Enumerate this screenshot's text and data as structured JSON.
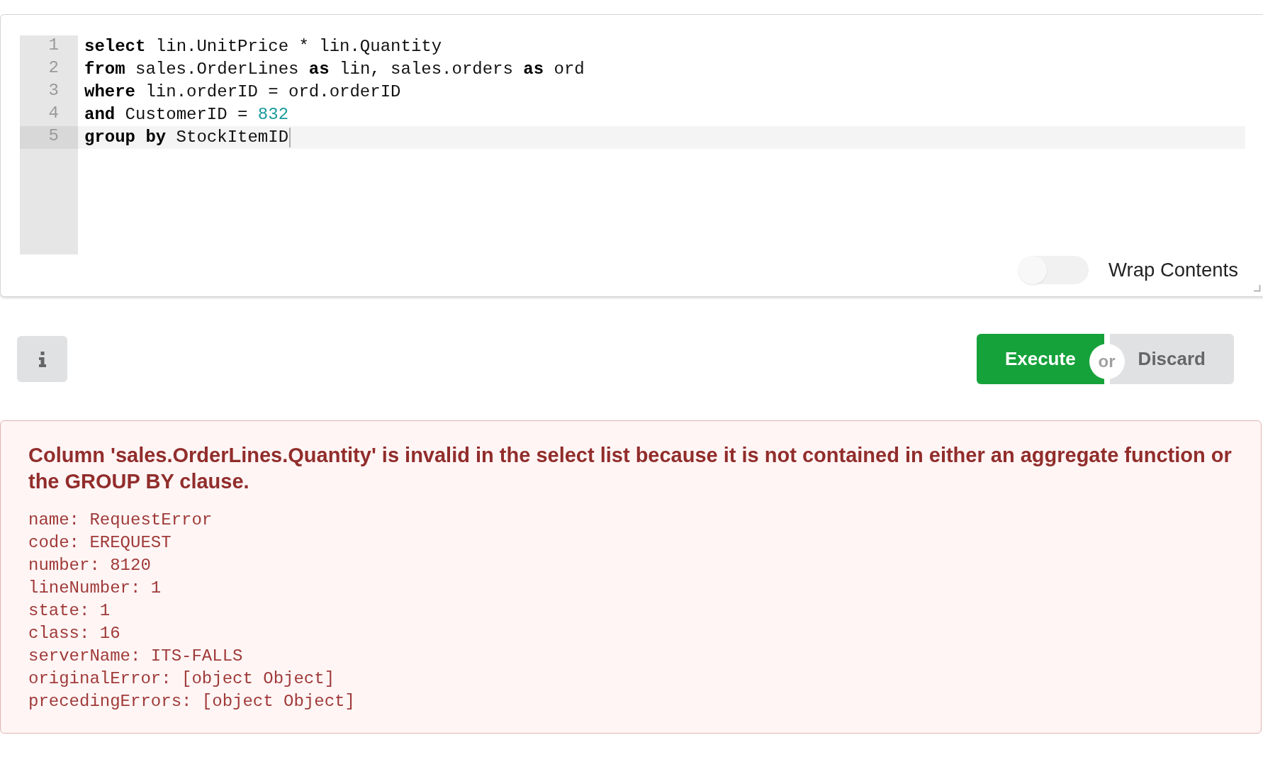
{
  "editor": {
    "lines": [
      {
        "number": "1",
        "active": false,
        "tokens": [
          {
            "kind": "keyword",
            "text": "select"
          },
          {
            "kind": "plain",
            "text": " lin.UnitPrice * lin.Quantity"
          }
        ]
      },
      {
        "number": "2",
        "active": false,
        "tokens": [
          {
            "kind": "keyword",
            "text": "from"
          },
          {
            "kind": "plain",
            "text": " sales.OrderLines "
          },
          {
            "kind": "keyword",
            "text": "as"
          },
          {
            "kind": "plain",
            "text": " lin, sales.orders "
          },
          {
            "kind": "keyword",
            "text": "as"
          },
          {
            "kind": "plain",
            "text": " ord"
          }
        ]
      },
      {
        "number": "3",
        "active": false,
        "tokens": [
          {
            "kind": "keyword",
            "text": "where"
          },
          {
            "kind": "plain",
            "text": " lin.orderID = ord.orderID"
          }
        ]
      },
      {
        "number": "4",
        "active": false,
        "tokens": [
          {
            "kind": "keyword",
            "text": "and"
          },
          {
            "kind": "plain",
            "text": " CustomerID = "
          },
          {
            "kind": "number",
            "text": "832"
          }
        ]
      },
      {
        "number": "5",
        "active": true,
        "tokens": [
          {
            "kind": "keyword",
            "text": "group by"
          },
          {
            "kind": "plain",
            "text": " StockItemID"
          }
        ]
      }
    ],
    "wrap_contents": {
      "label": "Wrap Contents",
      "on": false
    }
  },
  "actions": {
    "buttons": [
      {
        "kind": "primary",
        "label": "Execute"
      },
      {
        "kind": "secondary",
        "label": "Discard"
      }
    ],
    "separator": "or"
  },
  "error": {
    "message": "Column 'sales.OrderLines.Quantity' is invalid in the select list because it is not contained in either an aggregate function or the GROUP BY clause.",
    "details": [
      "name: RequestError",
      "code: EREQUEST",
      "number: 8120",
      "lineNumber: 1",
      "state: 1",
      "class: 16",
      "serverName: ITS-FALLS",
      "originalError: [object Object]",
      "precedingErrors: [object Object]"
    ]
  }
}
